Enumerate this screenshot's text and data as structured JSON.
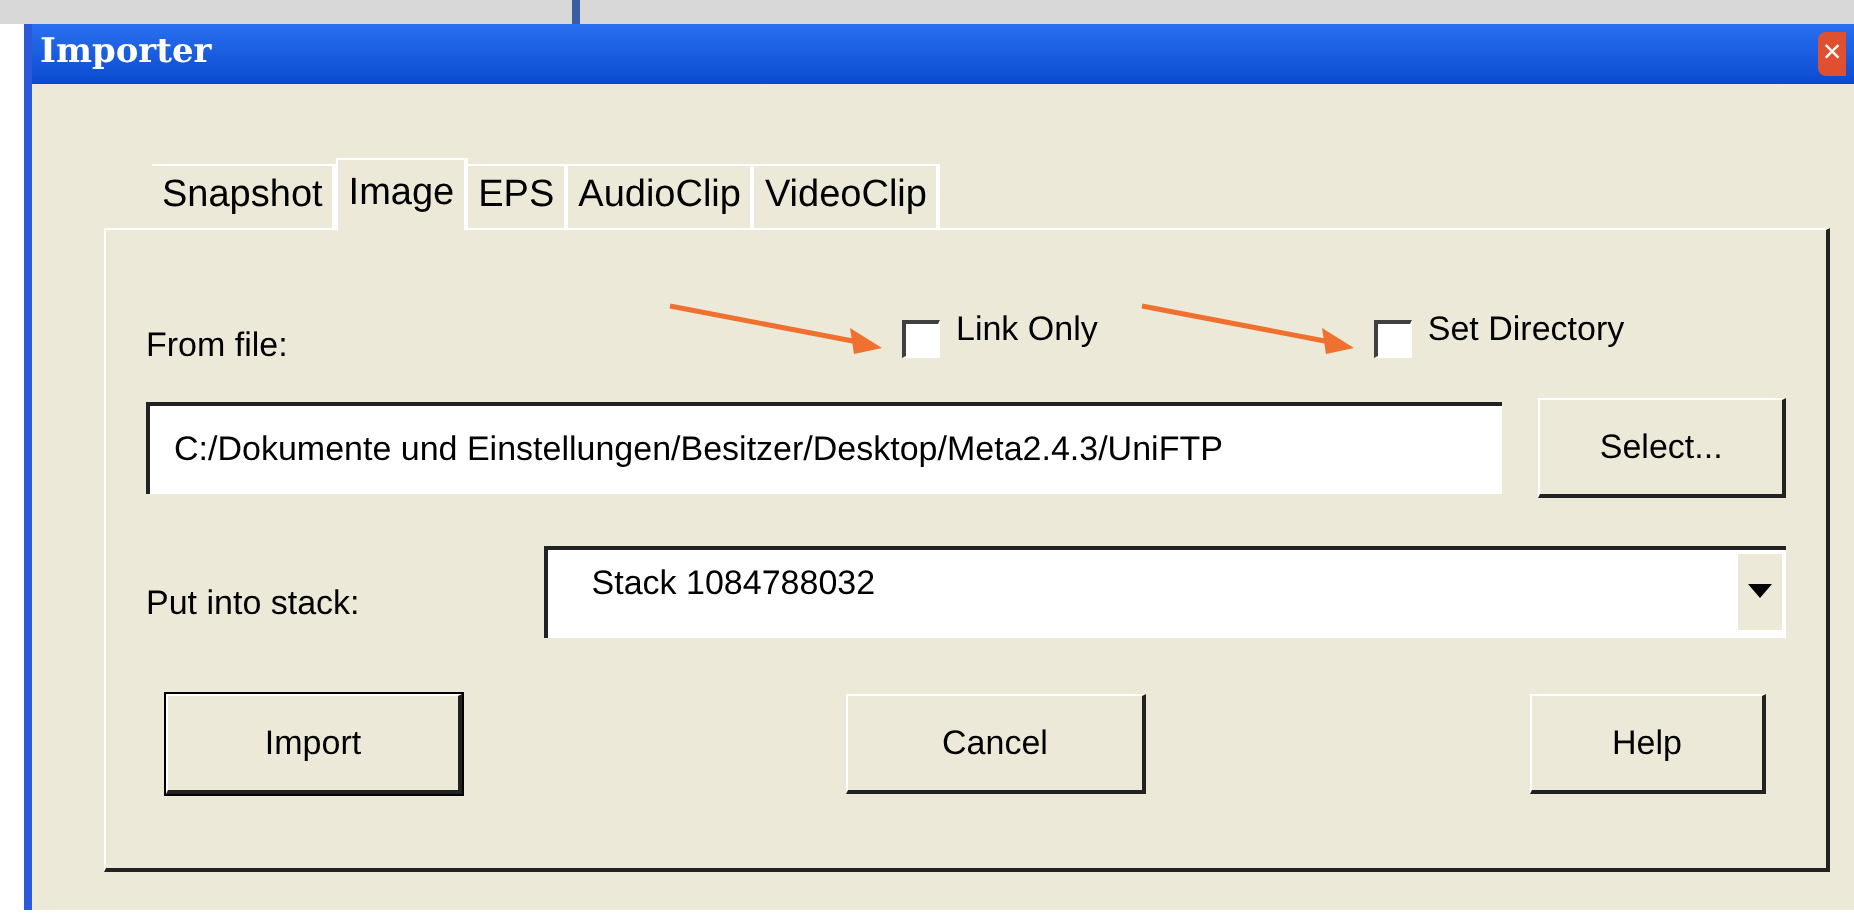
{
  "window": {
    "title": "Importer",
    "close": "×"
  },
  "tabs": [
    {
      "label": "Snapshot",
      "selected": false
    },
    {
      "label": "Image",
      "selected": true
    },
    {
      "label": "EPS",
      "selected": false
    },
    {
      "label": "AudioClip",
      "selected": false
    },
    {
      "label": "VideoClip",
      "selected": false
    }
  ],
  "options": [
    {
      "label": "Link Only",
      "checked": false
    },
    {
      "label": "Set Directory",
      "checked": false
    }
  ],
  "from_file": {
    "label": "From file:",
    "value": "C:/Dokumente und Einstellungen/Besitzer/Desktop/Meta2.4.3/UniFTP",
    "button": "Select..."
  },
  "stack": {
    "label": "Put into stack:",
    "value": "Stack 1084788032"
  },
  "buttons": [
    {
      "label": "Import",
      "default": true
    },
    {
      "label": "Cancel",
      "default": false
    },
    {
      "label": "Help",
      "default": false
    }
  ]
}
